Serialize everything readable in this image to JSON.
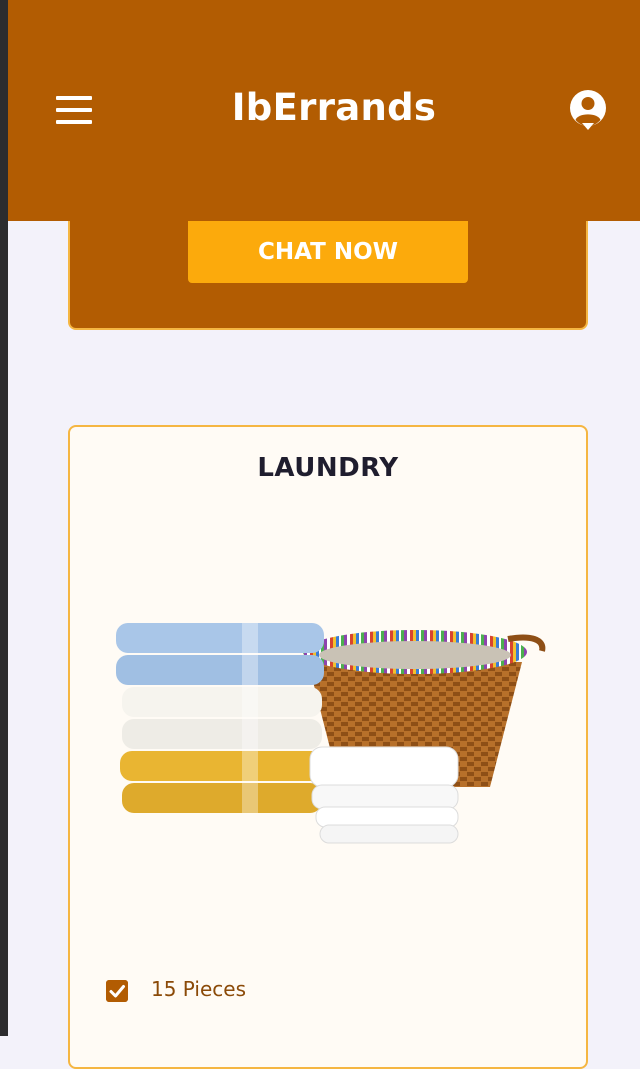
{
  "header": {
    "title": "IbErrands",
    "menu_icon": "hamburger-menu-icon",
    "profile_icon": "user-circle-icon",
    "background_color": "#b25c02"
  },
  "chat_card": {
    "button_label": "CHAT NOW",
    "button_color": "#fcaa0c"
  },
  "service_card": {
    "title": "LAUNDRY",
    "image": "laundry-towels-basket-image",
    "features": [
      {
        "label": "15 Pieces",
        "checked": true
      }
    ],
    "border_color": "#f5b642"
  }
}
